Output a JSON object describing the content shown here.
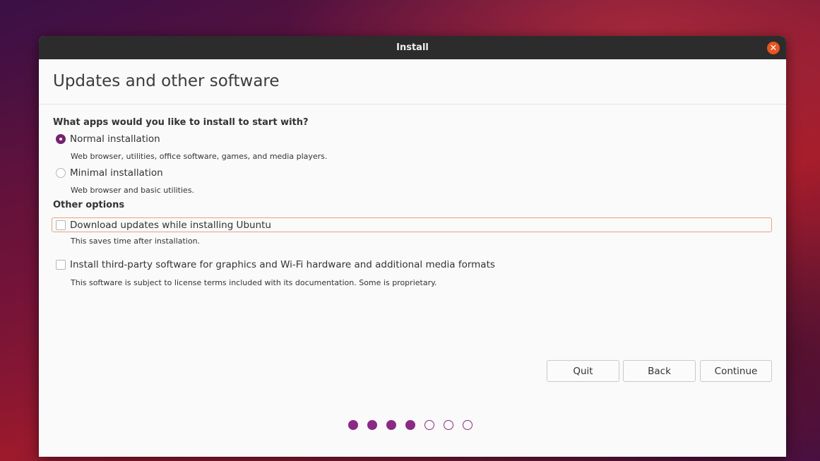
{
  "window": {
    "title": "Install"
  },
  "page": {
    "title": "Updates and other software"
  },
  "install_type": {
    "heading": "What apps would you like to install to start with?",
    "options": [
      {
        "label": "Normal installation",
        "description": "Web browser, utilities, office software, games, and media players.",
        "selected": true
      },
      {
        "label": "Minimal installation",
        "description": "Web browser and basic utilities.",
        "selected": false
      }
    ]
  },
  "other_options": {
    "heading": "Other options",
    "items": [
      {
        "label": "Download updates while installing Ubuntu",
        "description": "This saves time after installation.",
        "checked": false
      },
      {
        "label": "Install third-party software for graphics and Wi-Fi hardware and additional media formats",
        "description": "This software is subject to license terms included with its documentation. Some is proprietary.",
        "checked": false
      }
    ]
  },
  "buttons": {
    "quit": "Quit",
    "back": "Back",
    "continue": "Continue"
  },
  "progress": {
    "current_step": 4,
    "total_steps": 7
  },
  "colors": {
    "accent": "#77216f",
    "close": "#e95420",
    "titlebar": "#2c2c2c",
    "focus": "#e9a27f"
  },
  "icons": {
    "close": "close-icon"
  }
}
